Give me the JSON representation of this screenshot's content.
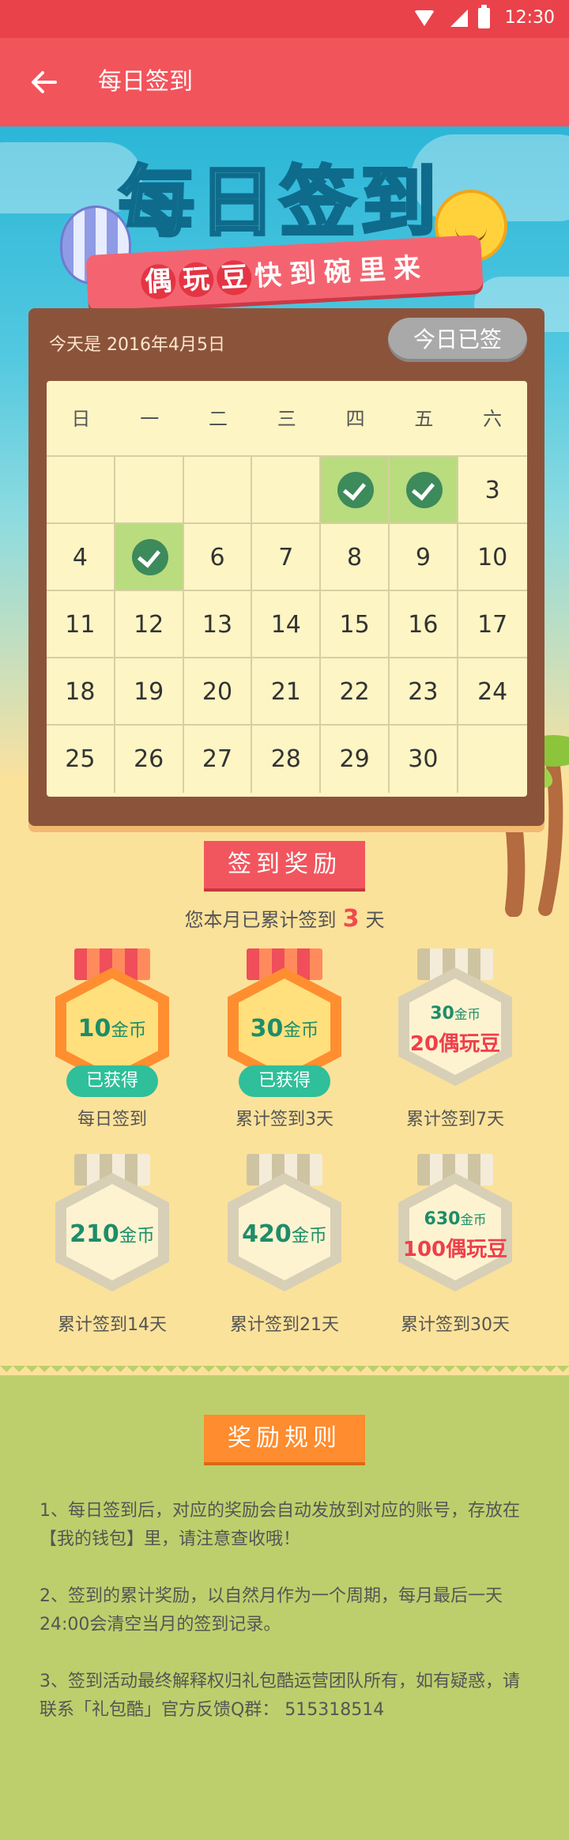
{
  "status_bar": {
    "time": "12:30"
  },
  "app_bar": {
    "title": "每日签到"
  },
  "banner": {
    "title": "每日签到",
    "subtitle_chars": [
      "偶",
      "玩",
      "豆"
    ],
    "subtitle_rest": "快到碗里来"
  },
  "calendar": {
    "today_text": "今天是 2016年4月5日",
    "signed_button": "今日已签",
    "weekdays": [
      "日",
      "一",
      "二",
      "三",
      "四",
      "五",
      "六"
    ],
    "weeks": [
      [
        "",
        "",
        "",
        "",
        "",
        "",
        "3"
      ],
      [
        "4",
        "",
        "6",
        "7",
        "8",
        "9",
        "10"
      ],
      [
        "11",
        "12",
        "13",
        "14",
        "15",
        "16",
        "17"
      ],
      [
        "18",
        "19",
        "20",
        "21",
        "22",
        "23",
        "24"
      ],
      [
        "25",
        "26",
        "27",
        "28",
        "29",
        "30",
        ""
      ]
    ],
    "signed_cells": [
      [
        0,
        4
      ],
      [
        0,
        5
      ],
      [
        1,
        1
      ]
    ]
  },
  "rewards_section": {
    "heading": "签到奖励",
    "summary_prefix": "您本月已累计签到",
    "summary_count": "3",
    "summary_suffix": "天",
    "items": [
      {
        "value": "10",
        "unit": "金币",
        "extra": "",
        "badge": "已获得",
        "label": "每日签到"
      },
      {
        "value": "30",
        "unit": "金币",
        "extra": "",
        "badge": "已获得",
        "label": "累计签到3天"
      },
      {
        "value": "30",
        "unit": "金币",
        "extra": "20偶玩豆",
        "badge": "",
        "label": "累计签到7天"
      },
      {
        "value": "210",
        "unit": "金币",
        "extra": "",
        "badge": "",
        "label": "累计签到14天"
      },
      {
        "value": "420",
        "unit": "金币",
        "extra": "",
        "badge": "",
        "label": "累计签到21天"
      },
      {
        "value": "630",
        "unit": "金币",
        "extra": "100偶玩豆",
        "badge": "",
        "label": "累计签到30天"
      }
    ]
  },
  "rules_section": {
    "heading": "奖励规则",
    "rules": [
      "1、每日签到后，对应的奖励会自动发放到对应的账号，存放在【我的钱包】里，请注意查收哦！",
      "2、签到的累计奖励，以自然月作为一个周期，每月最后一天24:00会清空当月的签到记录。",
      "3、签到活动最终解释权归礼包酷运营团队所有，如有疑惑，请联系「礼包酷」官方反馈Q群： 515318514"
    ]
  }
}
